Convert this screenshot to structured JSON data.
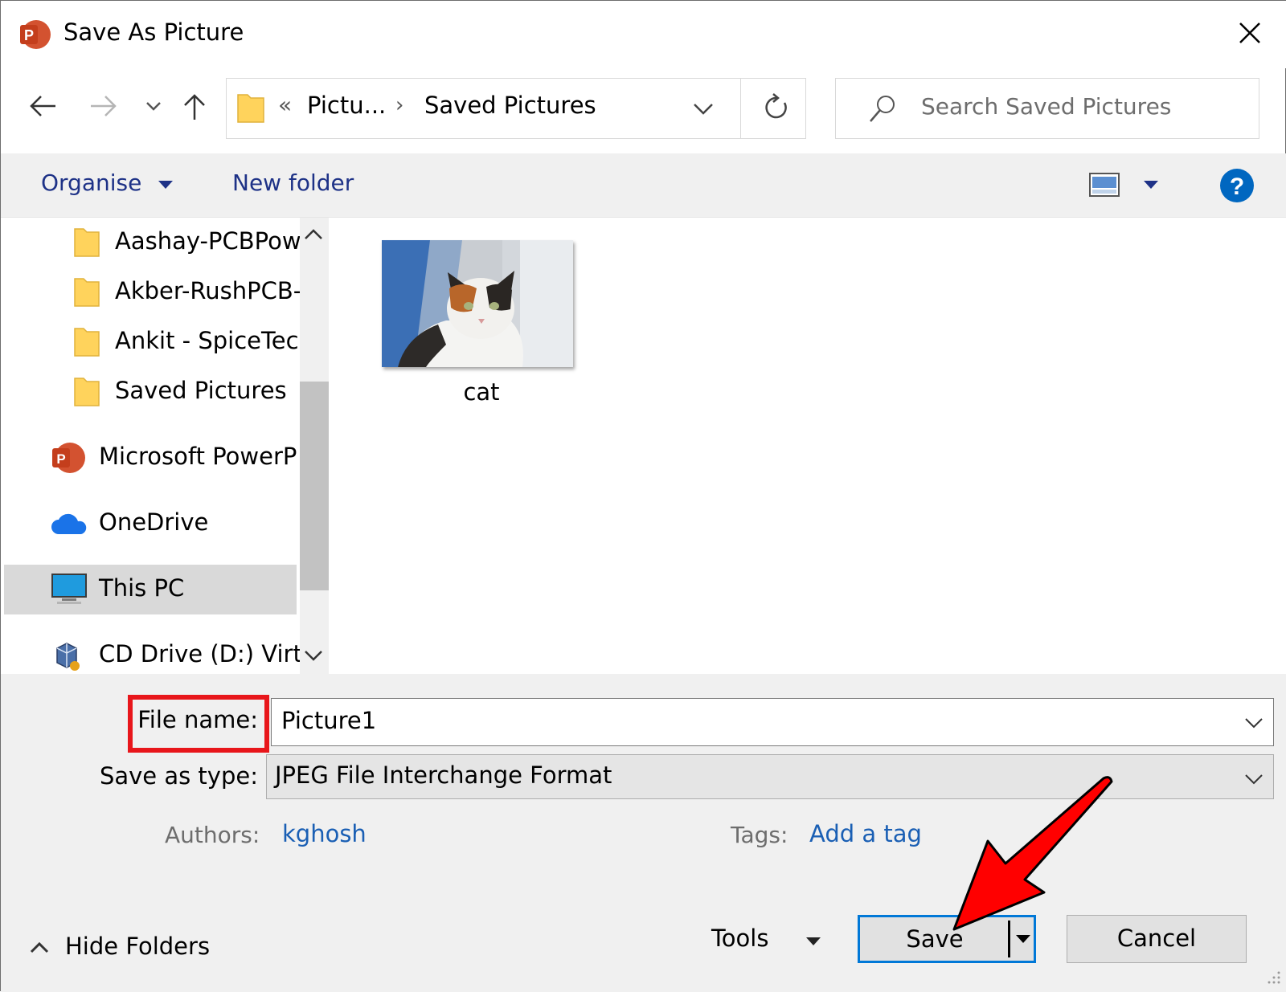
{
  "window": {
    "title": "Save As Picture",
    "app_icon_letter": "P"
  },
  "address_bar": {
    "overflow": "«",
    "crumbs": [
      "Pictu...",
      "Saved Pictures"
    ]
  },
  "search": {
    "placeholder": "Search Saved Pictures"
  },
  "toolbar": {
    "organise": "Organise",
    "new_folder": "New folder",
    "help": "?"
  },
  "nav_pane": {
    "items": [
      {
        "label": "Aashay-PCBPow",
        "icon": "folder-icon"
      },
      {
        "label": "Akber-RushPCB-",
        "icon": "folder-icon"
      },
      {
        "label": "Ankit - SpiceTecl",
        "icon": "folder-icon"
      },
      {
        "label": "Saved Pictures",
        "icon": "folder-icon"
      },
      {
        "label": "Microsoft PowerP",
        "icon": "powerpoint-icon"
      },
      {
        "label": "OneDrive",
        "icon": "onedrive-icon"
      },
      {
        "label": "This PC",
        "icon": "this-pc-icon",
        "selected": true
      },
      {
        "label": "CD Drive (D:) Virtu",
        "icon": "cd-drive-icon"
      }
    ]
  },
  "files": [
    {
      "name": "cat",
      "type": "image-thumbnail"
    }
  ],
  "form": {
    "file_name_label": "File name:",
    "file_name_value": "Picture1",
    "save_as_type_label": "Save as type:",
    "save_as_type_value": "JPEG File Interchange Format",
    "authors_label": "Authors:",
    "authors_value": "kghosh",
    "tags_label": "Tags:",
    "tags_value": "Add a tag"
  },
  "footer": {
    "hide_folders": "Hide Folders",
    "tools": "Tools",
    "save": "Save",
    "cancel": "Cancel"
  },
  "colors": {
    "accent": "#0078d7",
    "highlight_box": "#e8161b",
    "link": "#1a5fb4",
    "toolbar_text": "#1e3287",
    "annotation_arrow": "#ff0000"
  }
}
